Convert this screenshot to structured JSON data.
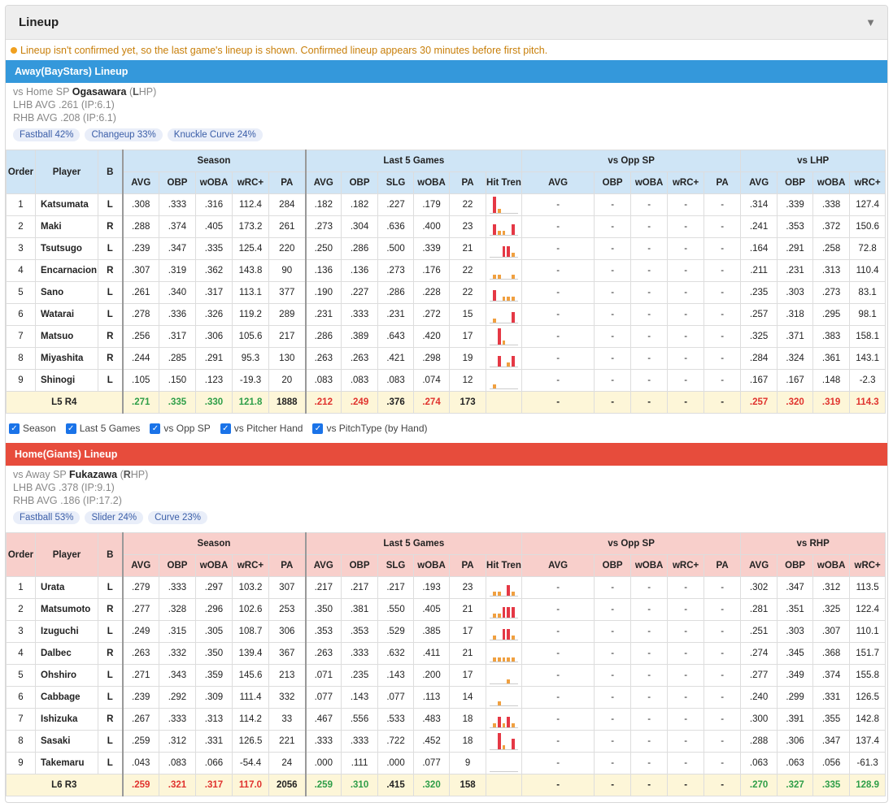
{
  "panel": {
    "title": "Lineup",
    "collapse_icon": "triangle-down-icon"
  },
  "notice": "Lineup isn't confirmed yet, so the last game's lineup is shown. Confirmed lineup appears 30 minutes before first pitch.",
  "colors": {
    "away": "#3498db",
    "home": "#e74c3c",
    "good": "#2e9e48",
    "bad": "#e0332e",
    "summary_bg": "#fdf6d8"
  },
  "columns": {
    "order": "Order",
    "player": "Player",
    "bat": "B",
    "groups": [
      "Season",
      "Last 5 Games",
      "vs Opp SP"
    ],
    "season": [
      "AVG",
      "OBP",
      "wOBA",
      "wRC+",
      "PA"
    ],
    "last5": [
      "AVG",
      "OBP",
      "SLG",
      "wOBA",
      "PA",
      "Hit Trend"
    ],
    "opp": [
      "AVG",
      "OBP",
      "wOBA",
      "wRC+",
      "PA"
    ],
    "hand": [
      "AVG",
      "OBP",
      "wOBA",
      "wRC+"
    ]
  },
  "filters": [
    "Season",
    "Last 5 Games",
    "vs Opp SP",
    "vs Pitcher Hand",
    "vs PitchType (by Hand)"
  ],
  "away": {
    "title": "Away(BayStars) Lineup",
    "vs_prefix": "vs Home SP",
    "pitcher": "Ogasawara",
    "hand_letter": "L",
    "hand_rest": "HP",
    "lhb": "LHB AVG .261 (IP:6.1)",
    "rhb": "RHB AVG .208 (IP:6.1)",
    "pitches": [
      "Fastball 42%",
      "Changeup 33%",
      "Knuckle Curve 24%"
    ],
    "hand_group": "vs LHP",
    "rows": [
      {
        "o": "1",
        "n": "Katsumata",
        "b": "L",
        "s": [
          ".308",
          ".333",
          ".316",
          "112.4",
          "284"
        ],
        "l": [
          ".182",
          ".182",
          ".227",
          ".179",
          "22"
        ],
        "t": [
          3,
          1,
          0,
          0,
          0
        ],
        "h": [
          ".314",
          ".339",
          ".338",
          "127.4"
        ]
      },
      {
        "o": "2",
        "n": "Maki",
        "b": "R",
        "s": [
          ".288",
          ".374",
          ".405",
          "173.2",
          "261"
        ],
        "l": [
          ".273",
          ".304",
          ".636",
          ".400",
          "23"
        ],
        "t": [
          2,
          1,
          1,
          0,
          2
        ],
        "h": [
          ".241",
          ".353",
          ".372",
          "150.6"
        ]
      },
      {
        "o": "3",
        "n": "Tsutsugo",
        "b": "L",
        "s": [
          ".239",
          ".347",
          ".335",
          "125.4",
          "220"
        ],
        "l": [
          ".250",
          ".286",
          ".500",
          ".339",
          "21"
        ],
        "t": [
          0,
          0,
          2,
          2,
          1
        ],
        "h": [
          ".164",
          ".291",
          ".258",
          "72.8"
        ]
      },
      {
        "o": "4",
        "n": "Encarnacion",
        "b": "R",
        "s": [
          ".307",
          ".319",
          ".362",
          "143.8",
          "90"
        ],
        "l": [
          ".136",
          ".136",
          ".273",
          ".176",
          "22"
        ],
        "t": [
          1,
          1,
          0,
          0,
          1
        ],
        "h": [
          ".211",
          ".231",
          ".313",
          "110.4"
        ]
      },
      {
        "o": "5",
        "n": "Sano",
        "b": "L",
        "s": [
          ".261",
          ".340",
          ".317",
          "113.1",
          "377"
        ],
        "l": [
          ".190",
          ".227",
          ".286",
          ".228",
          "22"
        ],
        "t": [
          2,
          0,
          1,
          1,
          1
        ],
        "h": [
          ".235",
          ".303",
          ".273",
          "83.1"
        ]
      },
      {
        "o": "6",
        "n": "Watarai",
        "b": "L",
        "s": [
          ".278",
          ".336",
          ".326",
          "119.2",
          "289"
        ],
        "l": [
          ".231",
          ".333",
          ".231",
          ".272",
          "15"
        ],
        "t": [
          1,
          0,
          0,
          0,
          2
        ],
        "h": [
          ".257",
          ".318",
          ".295",
          "98.1"
        ]
      },
      {
        "o": "7",
        "n": "Matsuo",
        "b": "R",
        "s": [
          ".256",
          ".317",
          ".306",
          "105.6",
          "217"
        ],
        "l": [
          ".286",
          ".389",
          ".643",
          ".420",
          "17"
        ],
        "t": [
          0,
          3,
          1,
          0,
          0
        ],
        "h": [
          ".325",
          ".371",
          ".383",
          "158.1"
        ]
      },
      {
        "o": "8",
        "n": "Miyashita",
        "b": "R",
        "s": [
          ".244",
          ".285",
          ".291",
          "95.3",
          "130"
        ],
        "l": [
          ".263",
          ".263",
          ".421",
          ".298",
          "19"
        ],
        "t": [
          0,
          2,
          0,
          1,
          2
        ],
        "h": [
          ".284",
          ".324",
          ".361",
          "143.1"
        ]
      },
      {
        "o": "9",
        "n": "Shinogi",
        "b": "L",
        "s": [
          ".105",
          ".150",
          ".123",
          "-19.3",
          "20"
        ],
        "l": [
          ".083",
          ".083",
          ".083",
          ".074",
          "12"
        ],
        "t": [
          1,
          0,
          0,
          0,
          0
        ],
        "h": [
          ".167",
          ".167",
          ".148",
          "-2.3"
        ]
      }
    ],
    "summary": {
      "label": "L5 R4",
      "s": [
        {
          "v": ".271",
          "c": "g"
        },
        {
          "v": ".335",
          "c": "g"
        },
        {
          "v": ".330",
          "c": "g"
        },
        {
          "v": "121.8",
          "c": "g"
        },
        {
          "v": "1888",
          "c": ""
        }
      ],
      "l": [
        {
          "v": ".212",
          "c": "r"
        },
        {
          "v": ".249",
          "c": "r"
        },
        {
          "v": ".376",
          "c": "k"
        },
        {
          "v": ".274",
          "c": "r"
        },
        {
          "v": "173",
          "c": ""
        }
      ],
      "h": [
        {
          "v": ".257",
          "c": "r"
        },
        {
          "v": ".320",
          "c": "r"
        },
        {
          "v": ".319",
          "c": "r"
        },
        {
          "v": "114.3",
          "c": "r"
        }
      ]
    }
  },
  "home": {
    "title": "Home(Giants) Lineup",
    "vs_prefix": "vs Away SP",
    "pitcher": "Fukazawa",
    "hand_letter": "R",
    "hand_rest": "HP",
    "lhb": "LHB AVG .378 (IP:9.1)",
    "rhb": "RHB AVG .186 (IP:17.2)",
    "pitches": [
      "Fastball 53%",
      "Slider 24%",
      "Curve 23%"
    ],
    "hand_group": "vs RHP",
    "rows": [
      {
        "o": "1",
        "n": "Urata",
        "b": "L",
        "s": [
          ".279",
          ".333",
          ".297",
          "103.2",
          "307"
        ],
        "l": [
          ".217",
          ".217",
          ".217",
          ".193",
          "23"
        ],
        "t": [
          1,
          1,
          0,
          2,
          1
        ],
        "h": [
          ".302",
          ".347",
          ".312",
          "113.5"
        ]
      },
      {
        "o": "2",
        "n": "Matsumoto",
        "b": "R",
        "s": [
          ".277",
          ".328",
          ".296",
          "102.6",
          "253"
        ],
        "l": [
          ".350",
          ".381",
          ".550",
          ".405",
          "21"
        ],
        "t": [
          1,
          1,
          2,
          2,
          2
        ],
        "h": [
          ".281",
          ".351",
          ".325",
          "122.4"
        ]
      },
      {
        "o": "3",
        "n": "Izuguchi",
        "b": "L",
        "s": [
          ".249",
          ".315",
          ".305",
          "108.7",
          "306"
        ],
        "l": [
          ".353",
          ".353",
          ".529",
          ".385",
          "17"
        ],
        "t": [
          1,
          0,
          2,
          2,
          1
        ],
        "h": [
          ".251",
          ".303",
          ".307",
          "110.1"
        ]
      },
      {
        "o": "4",
        "n": "Dalbec",
        "b": "R",
        "s": [
          ".263",
          ".332",
          ".350",
          "139.4",
          "367"
        ],
        "l": [
          ".263",
          ".333",
          ".632",
          ".411",
          "21"
        ],
        "t": [
          1,
          1,
          1,
          1,
          1
        ],
        "h": [
          ".274",
          ".345",
          ".368",
          "151.7"
        ]
      },
      {
        "o": "5",
        "n": "Ohshiro",
        "b": "L",
        "s": [
          ".271",
          ".343",
          ".359",
          "145.6",
          "213"
        ],
        "l": [
          ".071",
          ".235",
          ".143",
          ".200",
          "17"
        ],
        "t": [
          0,
          0,
          0,
          1,
          0
        ],
        "h": [
          ".277",
          ".349",
          ".374",
          "155.8"
        ]
      },
      {
        "o": "6",
        "n": "Cabbage",
        "b": "L",
        "s": [
          ".239",
          ".292",
          ".309",
          "111.4",
          "332"
        ],
        "l": [
          ".077",
          ".143",
          ".077",
          ".113",
          "14"
        ],
        "t": [
          0,
          1,
          0,
          0,
          0
        ],
        "h": [
          ".240",
          ".299",
          ".331",
          "126.5"
        ]
      },
      {
        "o": "7",
        "n": "Ishizuka",
        "b": "R",
        "s": [
          ".267",
          ".333",
          ".313",
          "114.2",
          "33"
        ],
        "l": [
          ".467",
          ".556",
          ".533",
          ".483",
          "18"
        ],
        "t": [
          1,
          2,
          1,
          2,
          1
        ],
        "h": [
          ".300",
          ".391",
          ".355",
          "142.8"
        ]
      },
      {
        "o": "8",
        "n": "Sasaki",
        "b": "L",
        "s": [
          ".259",
          ".312",
          ".331",
          "126.5",
          "221"
        ],
        "l": [
          ".333",
          ".333",
          ".722",
          ".452",
          "18"
        ],
        "t": [
          0,
          3,
          1,
          0,
          2
        ],
        "h": [
          ".288",
          ".306",
          ".347",
          "137.4"
        ]
      },
      {
        "o": "9",
        "n": "Takemaru",
        "b": "L",
        "s": [
          ".043",
          ".083",
          ".066",
          "-54.4",
          "24"
        ],
        "l": [
          ".000",
          ".111",
          ".000",
          ".077",
          "9"
        ],
        "t": [
          0,
          0,
          0,
          0,
          0
        ],
        "h": [
          ".063",
          ".063",
          ".056",
          "-61.3"
        ]
      }
    ],
    "summary": {
      "label": "L6 R3",
      "s": [
        {
          "v": ".259",
          "c": "r"
        },
        {
          "v": ".321",
          "c": "r"
        },
        {
          "v": ".317",
          "c": "r"
        },
        {
          "v": "117.0",
          "c": "r"
        },
        {
          "v": "2056",
          "c": ""
        }
      ],
      "l": [
        {
          "v": ".259",
          "c": "g"
        },
        {
          "v": ".310",
          "c": "g"
        },
        {
          "v": ".415",
          "c": "k"
        },
        {
          "v": ".320",
          "c": "g"
        },
        {
          "v": "158",
          "c": ""
        }
      ],
      "h": [
        {
          "v": ".270",
          "c": "g"
        },
        {
          "v": ".327",
          "c": "g"
        },
        {
          "v": ".335",
          "c": "g"
        },
        {
          "v": "128.9",
          "c": "g"
        }
      ]
    }
  },
  "dash": "-"
}
